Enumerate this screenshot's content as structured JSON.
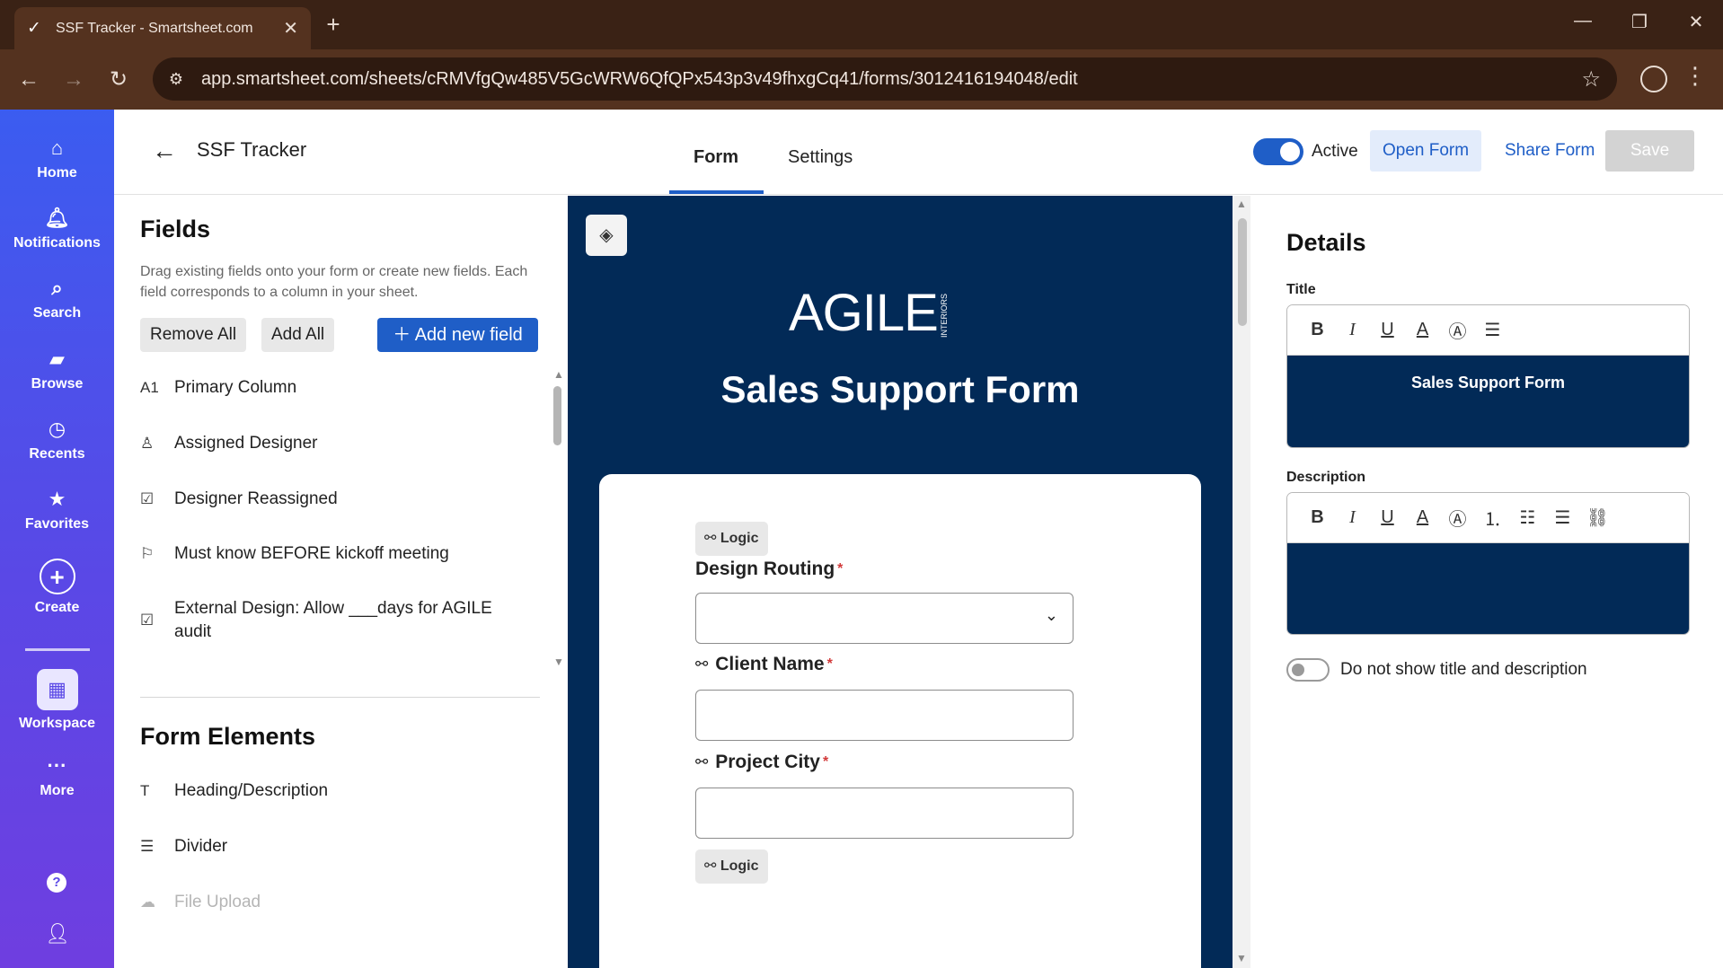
{
  "browser": {
    "tab_title": "SSF Tracker - Smartsheet.com",
    "url": "app.smartsheet.com/sheets/cRMVfgQw485V5GcWRW6QfQPx543p3v49fhxgCq41/forms/3012416194048/edit"
  },
  "appnav": {
    "items": [
      {
        "label": "Home",
        "icon": "home-icon"
      },
      {
        "label": "Notifications",
        "icon": "bell-icon"
      },
      {
        "label": "Search",
        "icon": "search-icon"
      },
      {
        "label": "Browse",
        "icon": "folder-icon"
      },
      {
        "label": "Recents",
        "icon": "clock-icon"
      },
      {
        "label": "Favorites",
        "icon": "star-icon"
      },
      {
        "label": "Create",
        "icon": "plus-circle-icon"
      },
      {
        "label": "Workspace",
        "icon": "workspace-icon"
      },
      {
        "label": "More",
        "icon": "more-icon"
      }
    ]
  },
  "header": {
    "sheet_name": "SSF Tracker",
    "tabs": [
      {
        "label": "Form"
      },
      {
        "label": "Settings"
      }
    ],
    "active_label": "Active",
    "open_form": "Open Form",
    "share_form": "Share Form",
    "save": "Save"
  },
  "fields_panel": {
    "title": "Fields",
    "description": "Drag existing fields onto your form or create new fields. Each field corresponds to a column in your sheet.",
    "remove_all": "Remove All",
    "add_all": "Add All",
    "add_new_field": "Add new field",
    "fields": [
      {
        "label": "Primary Column",
        "icon": "text-number-icon"
      },
      {
        "label": "Assigned Designer",
        "icon": "contact-icon"
      },
      {
        "label": "Designer Reassigned",
        "icon": "checkbox-icon"
      },
      {
        "label": "Must know BEFORE kickoff meeting",
        "icon": "flag-icon"
      },
      {
        "label": "External Design: Allow ___days for AGILE audit",
        "icon": "checkbox-icon"
      }
    ],
    "form_elements_title": "Form Elements",
    "form_elements": [
      {
        "label": "Heading/Description",
        "icon": "text-heading-icon"
      },
      {
        "label": "Divider",
        "icon": "divider-icon"
      },
      {
        "label": "File Upload",
        "icon": "upload-icon"
      }
    ]
  },
  "preview": {
    "logo_text": "AGILE",
    "logo_sub": "INTERIORS",
    "title": "Sales Support Form",
    "logic_label": "Logic",
    "questions": [
      {
        "label": "Design Routing",
        "required": "*"
      },
      {
        "label": "Client Name",
        "required": "*"
      },
      {
        "label": "Project City",
        "required": "*"
      }
    ]
  },
  "details": {
    "title": "Details",
    "title_label": "Title",
    "title_value": "Sales Support Form",
    "description_label": "Description",
    "description_value": "",
    "hide_toggle_label": "Do not show title and description"
  },
  "colors": {
    "brand_blue": "#1f5ec7",
    "form_navy": "#022a57",
    "nav_gradient_top": "#3b5cf0",
    "nav_gradient_bottom": "#6f3ee0",
    "required_red": "#d23a3a"
  }
}
